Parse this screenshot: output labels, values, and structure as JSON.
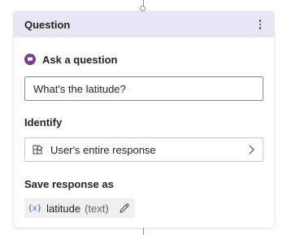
{
  "node": {
    "title": "Question",
    "menu_icon": "more-vertical-icon"
  },
  "message": {
    "icon": "message-bubble-icon",
    "label": "Ask a question",
    "text": "What's the latitude?"
  },
  "identify": {
    "label": "Identify",
    "icon": "entity-grid-icon",
    "selected": "User's entire response",
    "chevron": "chevron-right-icon"
  },
  "save": {
    "label": "Save response as",
    "variable_icon": "{x}",
    "variable_name": "latitude",
    "variable_type": "(text)",
    "edit_icon": "pencil-icon"
  },
  "colors": {
    "header_bg": "#e8e6f4",
    "message_icon": "#7a3d91",
    "variable_icon": "#3b5ccc"
  }
}
